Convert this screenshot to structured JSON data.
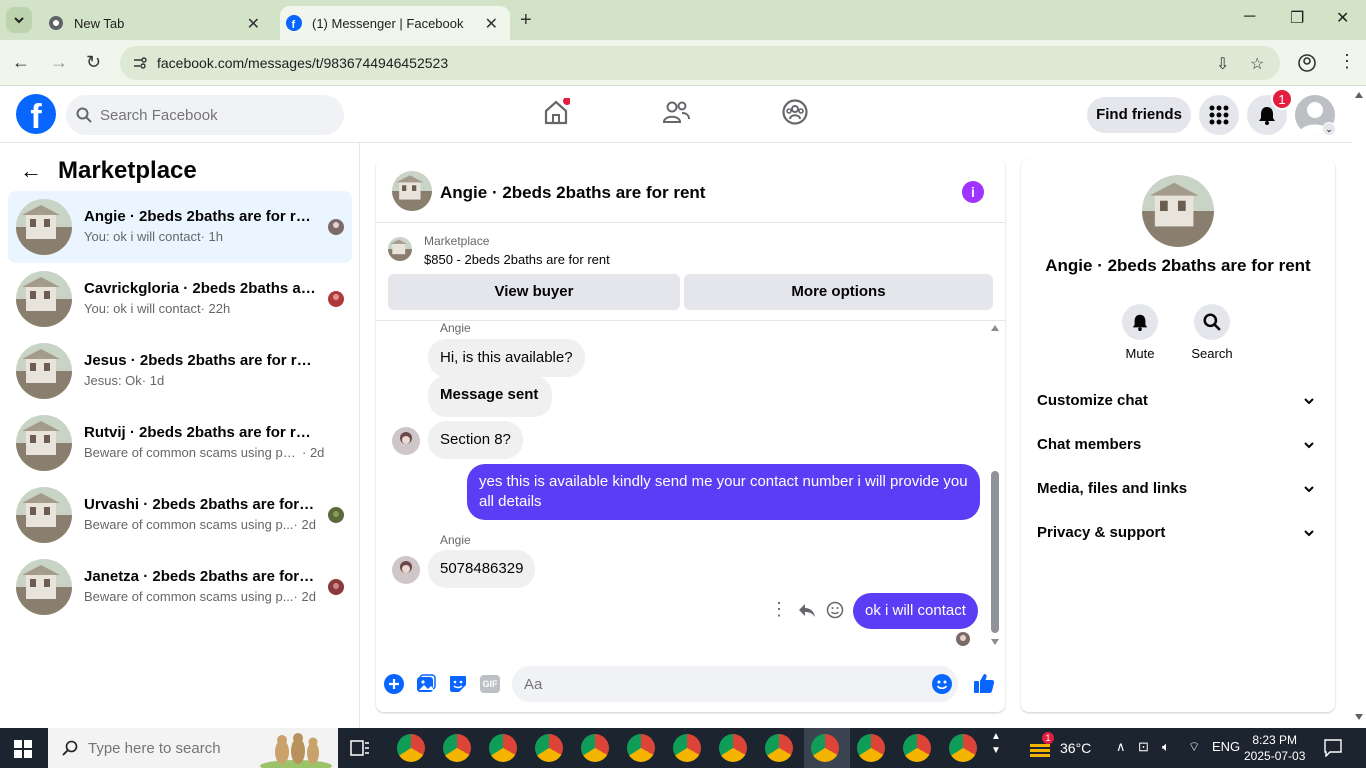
{
  "browser": {
    "tabs": [
      {
        "title": "New Tab"
      },
      {
        "title": "(1) Messenger | Facebook"
      }
    ],
    "url": "facebook.com/messages/t/9836744946452523"
  },
  "fb": {
    "search_placeholder": "Search Facebook",
    "find_friends": "Find friends",
    "notif_count": "1"
  },
  "marketplace": {
    "title": "Marketplace",
    "conversations": [
      {
        "name": "Angie · 2beds 2baths are for rent",
        "snippet": "You: ok i will contact",
        "time": "· 1h"
      },
      {
        "name": "Cavrickgloria · 2beds 2baths are...",
        "snippet": "You: ok i will contact",
        "time": "· 22h"
      },
      {
        "name": "Jesus · 2beds 2baths are for rent",
        "snippet": "Jesus: Ok",
        "time": "· 1d"
      },
      {
        "name": "Rutvij · 2beds 2baths are for rent",
        "snippet": "Beware of common scams using pay...",
        "time": "· 2d"
      },
      {
        "name": "Urvashi · 2beds 2baths are for r...",
        "snippet": "Beware of common scams using p...",
        "time": "· 2d"
      },
      {
        "name": "Janetza · 2beds 2baths are for re...",
        "snippet": "Beware of common scams using p...",
        "time": "· 2d"
      }
    ]
  },
  "chat": {
    "title": "Angie · 2beds 2baths are for rent",
    "listing_label": "Marketplace",
    "listing": "$850 - 2beds 2baths are for rent",
    "view_buyer": "View buyer",
    "more_options": "More options",
    "sender_name": "Angie",
    "messages": {
      "m1": "Hi, is this available?",
      "m2": "Message sent",
      "m3": "Section 8?",
      "m4": "yes  this is available kindly send me your contact number i will provide you all details",
      "m5": "5078486329",
      "m6": "ok i will contact"
    },
    "composer_placeholder": "Aa",
    "gif_label": "GIF"
  },
  "details": {
    "name": "Angie · 2beds 2baths are for rent",
    "mute": "Mute",
    "search": "Search",
    "sections": [
      "Customize chat",
      "Chat members",
      "Media, files and links",
      "Privacy & support"
    ]
  },
  "taskbar": {
    "search_placeholder": "Type here to search",
    "temperature": "36°C",
    "weather_badge": "1",
    "language": "ENG",
    "time": "8:23 PM",
    "date": "2025-07-03"
  },
  "colors": {
    "fb_blue": "#0866ff",
    "outgoing_bubble": "#5b3df5",
    "active_conversation": "#ebf5ff",
    "browser_chrome": "#d3e3c8"
  }
}
